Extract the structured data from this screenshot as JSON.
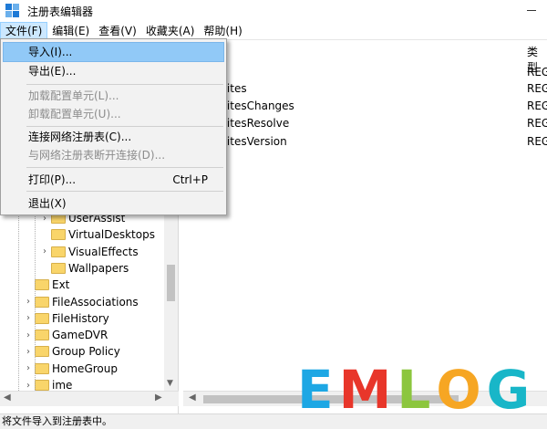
{
  "window": {
    "title": "注册表编辑器"
  },
  "menubar": {
    "items": [
      "文件(F)",
      "编辑(E)",
      "查看(V)",
      "收藏夹(A)",
      "帮助(H)"
    ],
    "active_index": 0
  },
  "file_menu": {
    "items": [
      {
        "label": "导入(I)...",
        "enabled": true,
        "highlighted": true
      },
      {
        "label": "导出(E)...",
        "enabled": true
      },
      {
        "label": "加载配置单元(L)...",
        "enabled": false
      },
      {
        "label": "卸载配置单元(U)...",
        "enabled": false
      },
      {
        "label": "连接网络注册表(C)...",
        "enabled": true
      },
      {
        "label": "与网络注册表断开连接(D)...",
        "enabled": false
      },
      {
        "label": "打印(P)...",
        "enabled": true,
        "shortcut": "Ctrl+P"
      },
      {
        "label": "退出(X)",
        "enabled": true
      }
    ]
  },
  "tree": {
    "items": [
      {
        "label": "UserAssist",
        "expandable": true
      },
      {
        "label": "VirtualDesktops",
        "expandable": false
      },
      {
        "label": "VisualEffects",
        "expandable": true
      },
      {
        "label": "Wallpapers",
        "expandable": false
      },
      {
        "label": "Ext",
        "expandable": false
      },
      {
        "label": "FileAssociations",
        "expandable": true
      },
      {
        "label": "FileHistory",
        "expandable": true
      },
      {
        "label": "GameDVR",
        "expandable": true
      },
      {
        "label": "Group Policy",
        "expandable": true
      },
      {
        "label": "HomeGroup",
        "expandable": true
      },
      {
        "label": "ime",
        "expandable": true
      }
    ]
  },
  "list": {
    "type_header": "类型",
    "rows": [
      {
        "name": ")",
        "type": "REG"
      },
      {
        "name": "rites",
        "type": "REG"
      },
      {
        "name": "ritesChanges",
        "type": "REG"
      },
      {
        "name": "ritesResolve",
        "type": "REG"
      },
      {
        "name": "ritesVersion",
        "type": "REG"
      }
    ]
  },
  "status": {
    "text": "将文件导入到注册表中。"
  },
  "watermark": {
    "letters": [
      "E",
      "M",
      "L",
      "O",
      "G"
    ],
    "colors": [
      "#1da7e4",
      "#e8362a",
      "#8cc63e",
      "#f6a623",
      "#18b6c8"
    ]
  }
}
